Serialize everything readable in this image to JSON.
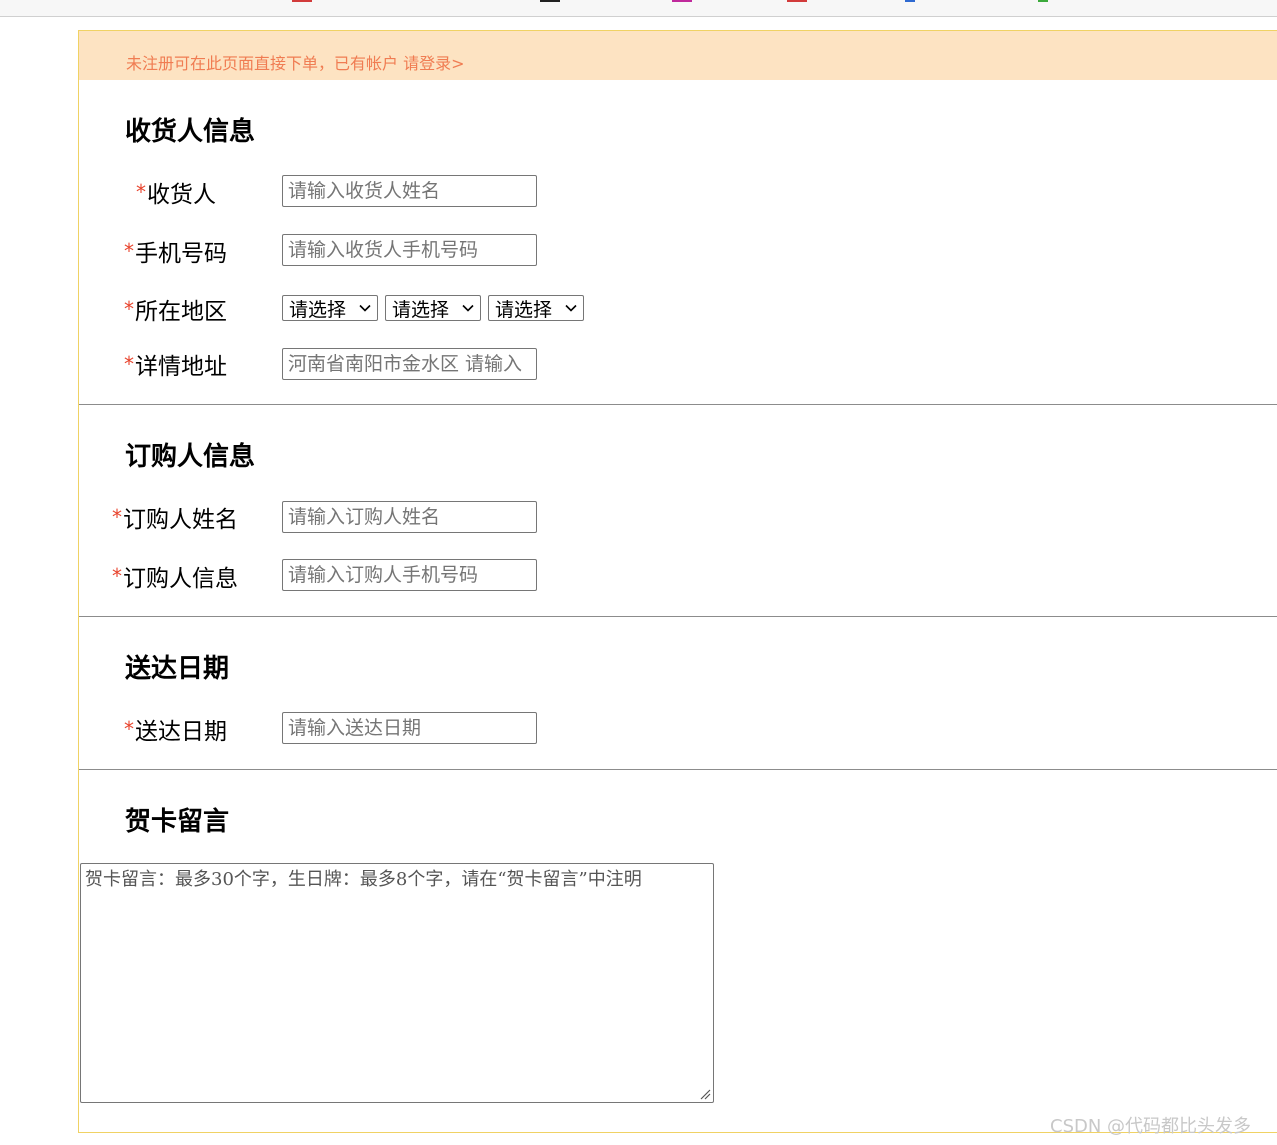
{
  "notice": {
    "text": "未注册可在此页面直接下单，已有帐户",
    "login_link": "请登录>"
  },
  "required_mark": "*",
  "consignee": {
    "title": "收货人信息",
    "name_label": "收货人",
    "name_placeholder": "请输入收货人姓名",
    "phone_label": "手机号码",
    "phone_placeholder": "请输入收货人手机号码",
    "region_label": "所在地区",
    "region_selects": [
      "请选择",
      "请选择",
      "请选择"
    ],
    "address_label": "详情地址",
    "address_placeholder": "河南省南阳市金水区 请输入"
  },
  "buyer": {
    "title": "订购人信息",
    "name_label": "订购人姓名",
    "name_placeholder": "请输入订购人姓名",
    "info_label": "订购人信息",
    "info_placeholder": "请输入订购人手机号码"
  },
  "delivery": {
    "title": "送达日期",
    "date_label": "送达日期",
    "date_placeholder": "请输入送达日期"
  },
  "card": {
    "title": "贺卡留言",
    "placeholder": "贺卡留言：最多30个字，生日牌：最多8个字，请在“贺卡留言”中注明"
  },
  "watermark": "CSDN @代码都比头发多",
  "colors": {
    "notice_bg": "#fde3c2",
    "notice_text": "#f07c52",
    "required": "#e8442d",
    "border": "#f0d264"
  }
}
